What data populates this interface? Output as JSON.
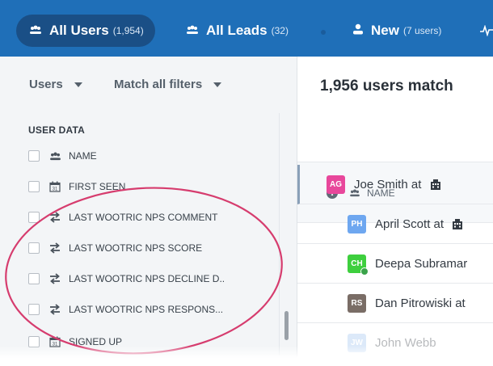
{
  "nav": {
    "tabs": [
      {
        "label": "All Users",
        "count": "(1,954)"
      },
      {
        "label": "All Leads",
        "count": "(32)"
      },
      {
        "label": "New",
        "count": "(7 users)"
      }
    ]
  },
  "filters": {
    "scope": "Users",
    "mode": "Match all filters"
  },
  "user_data": {
    "title": "USER DATA",
    "items": [
      {
        "label": "NAME",
        "icon": "users-icon"
      },
      {
        "label": "FIRST SEEN",
        "icon": "calendar-icon"
      },
      {
        "label": "LAST WOOTRIC NPS COMMENT",
        "icon": "sync-arrows-icon"
      },
      {
        "label": "LAST WOOTRIC NPS SCORE",
        "icon": "sync-arrows-icon"
      },
      {
        "label": "LAST WOOTRIC NPS DECLINE D..",
        "icon": "sync-arrows-icon"
      },
      {
        "label": "LAST WOOTRIC NPS RESPONS...",
        "icon": "sync-arrows-icon"
      },
      {
        "label": "SIGNED UP",
        "icon": "calendar-icon"
      }
    ]
  },
  "results": {
    "summary": "1,956 users match",
    "column": "NAME",
    "rows": [
      {
        "initials": "AG",
        "name": "Joe Smith at",
        "color": "#e8479b"
      },
      {
        "initials": "PH",
        "name": "April Scott at",
        "color": "#6ea7f0"
      },
      {
        "initials": "CH",
        "name": "Deepa Subramar",
        "color": "#3ecf3e"
      },
      {
        "initials": "RS",
        "name": "Dan Pitrowiski at",
        "color": "#7a6d66"
      },
      {
        "initials": "JW",
        "name": "John Webb",
        "color": "#9cc3f0"
      }
    ]
  },
  "colors": {
    "topbar": "#1f6fb8",
    "annotation": "#d63c6e"
  }
}
